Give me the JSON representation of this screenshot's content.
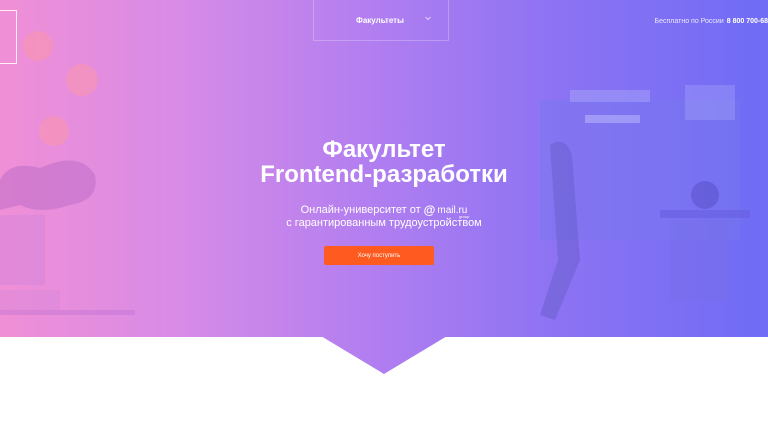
{
  "header": {
    "menu_label": "Факультеты",
    "chevron_icon": "chevron-down-icon",
    "phone_caption": "Бесплатно по России",
    "phone_number": "8 800 700-68"
  },
  "hero": {
    "title_line1": "Факультет",
    "title_line2": "Frontend-разработки",
    "subtitle_prefix": "Онлайн-университет от",
    "brand_at": "@",
    "brand_name": "mail.ru",
    "brand_group": "group",
    "subtitle_line2": "с гарантированным трудоустройством",
    "cta_label": "Хочу поступить"
  },
  "colors": {
    "gradient_left": "#f08fd6",
    "gradient_right": "#6f6cf5",
    "cta": "#ff5a1f"
  }
}
